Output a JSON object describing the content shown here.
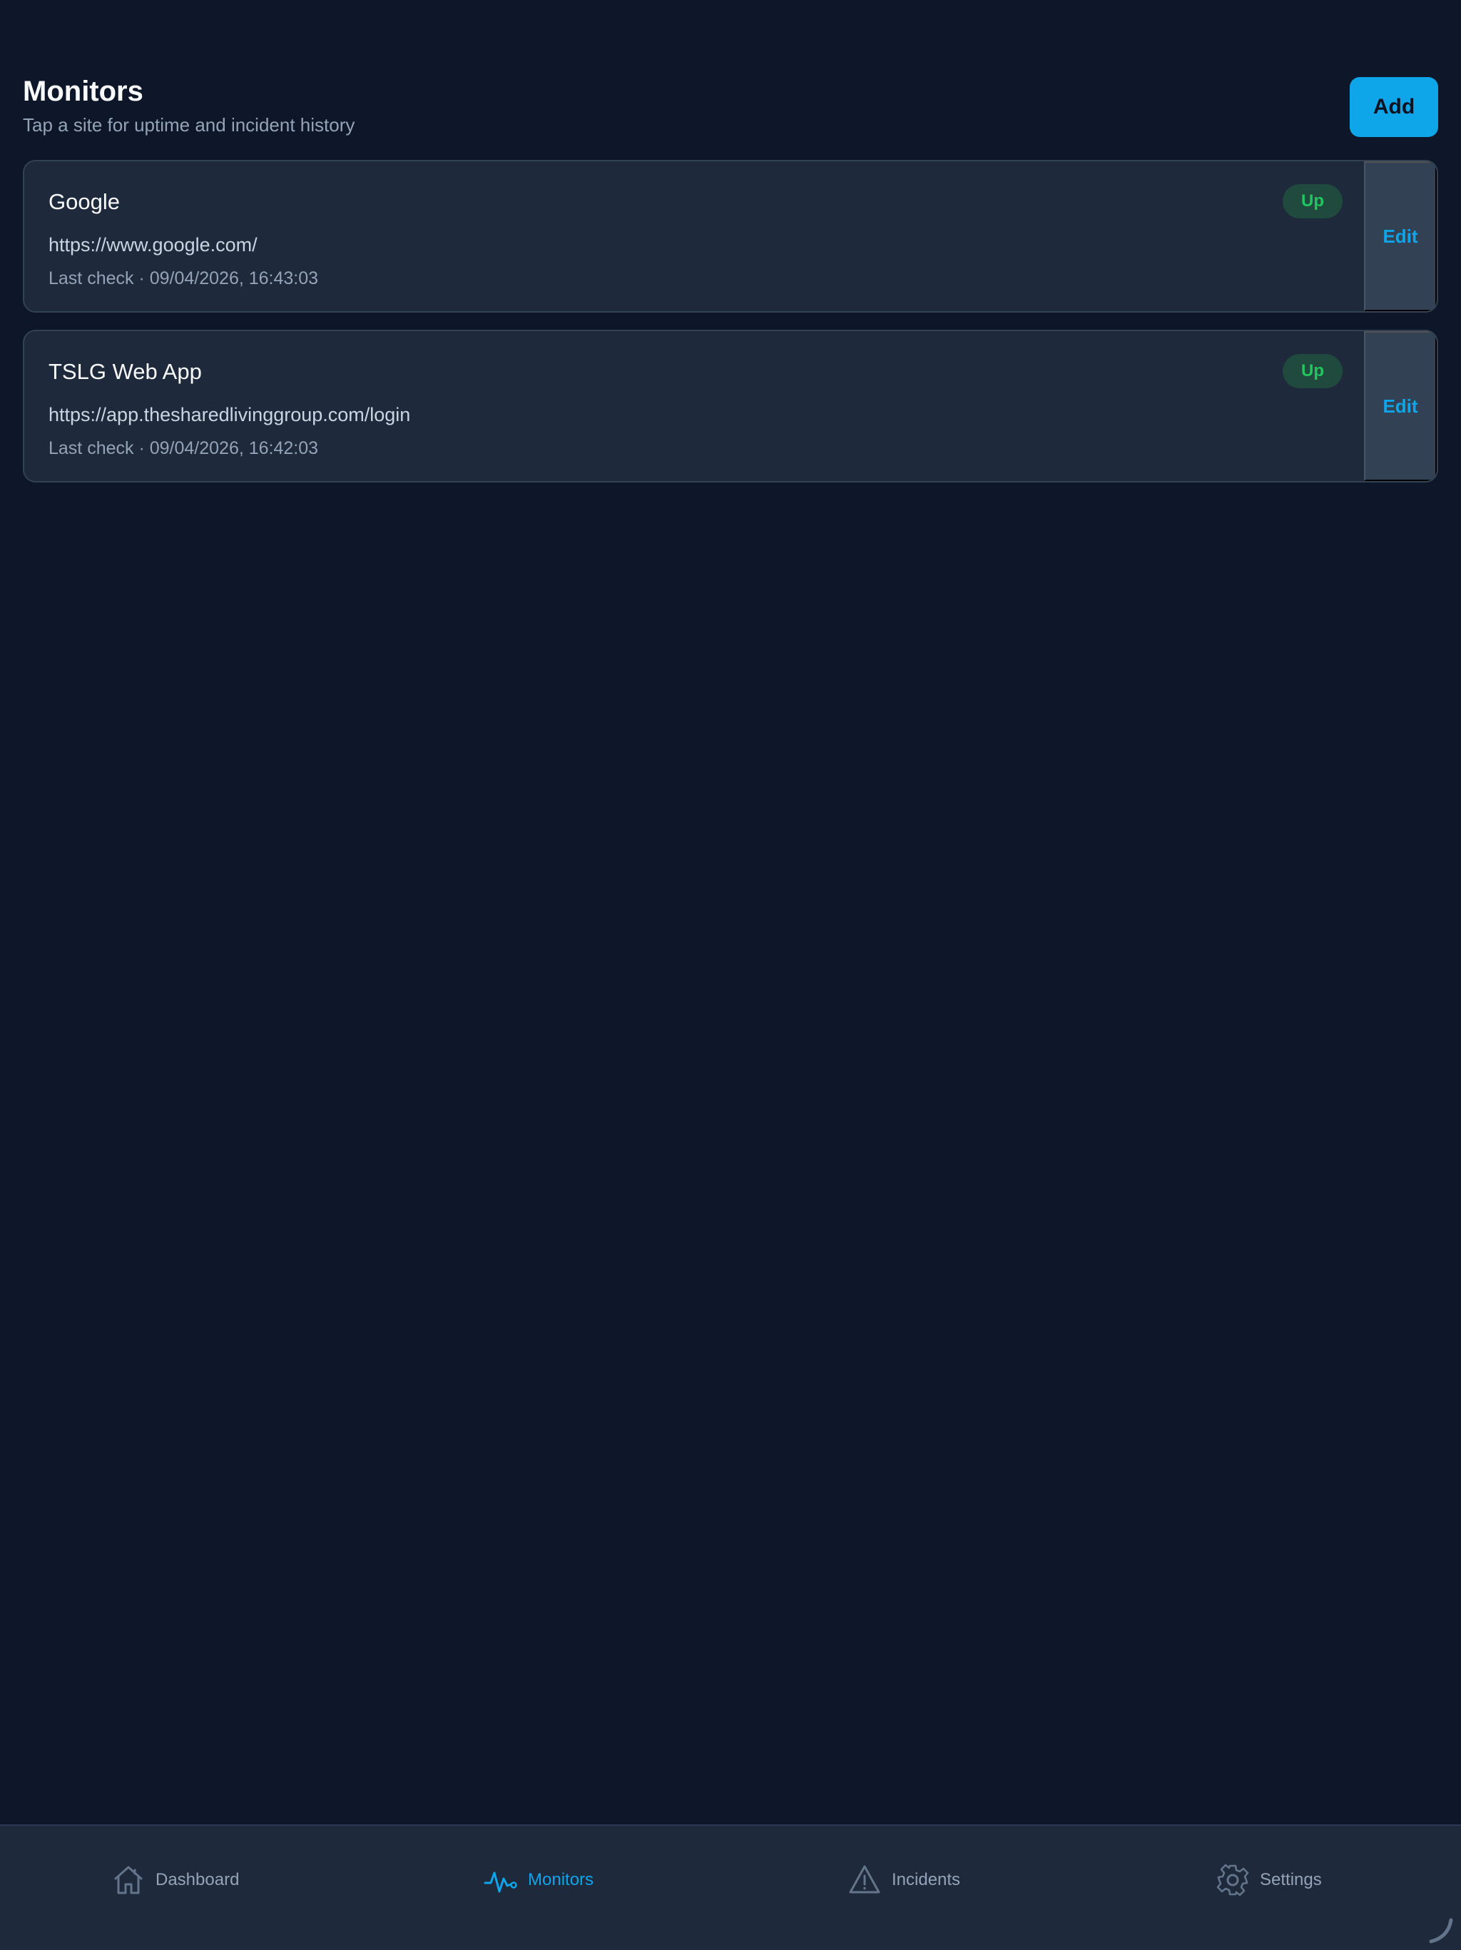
{
  "header": {
    "title": "Monitors",
    "subtitle": "Tap a site for uptime and incident history",
    "add_label": "Add"
  },
  "monitors": [
    {
      "name": "Google",
      "url": "https://www.google.com/",
      "last_check": "Last check · 09/04/2026, 16:43:03",
      "status": "Up",
      "edit_label": "Edit"
    },
    {
      "name": "TSLG Web App",
      "url": "https://app.thesharedlivinggroup.com/login",
      "last_check": "Last check · 09/04/2026, 16:42:03",
      "status": "Up",
      "edit_label": "Edit"
    }
  ],
  "tabbar": {
    "items": [
      {
        "label": "Dashboard",
        "icon": "house-icon",
        "active": false
      },
      {
        "label": "Monitors",
        "icon": "pulse-icon",
        "active": true
      },
      {
        "label": "Incidents",
        "icon": "warning-triangle-icon",
        "active": false
      },
      {
        "label": "Settings",
        "icon": "gear-icon",
        "active": false
      }
    ]
  },
  "colors": {
    "background": "#0e1729",
    "card": "#1e293b",
    "accent": "#0ea5e9",
    "status_up": "#22c55e",
    "muted": "#94a3b8"
  }
}
